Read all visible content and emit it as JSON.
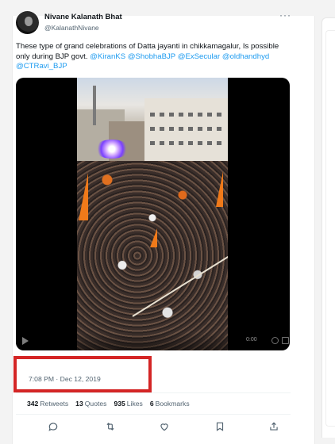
{
  "tweet": {
    "author_name": "Nivane Kalanath Bhat",
    "author_handle": "@KalanathNivane",
    "more_icon": "···",
    "text_plain": "These type of grand celebrations of Datta jayanti in chikkamagalur, Is possible only during BJP govt.",
    "mentions": [
      "@KiranKS",
      "@ShobhaBJP",
      "@ExSecular",
      "@oldhandhyd",
      "@CTRavi_BJP"
    ],
    "video_time": "0:00",
    "timestamp": "7:08 PM · Dec 12, 2019"
  },
  "stats": {
    "retweets_count": "342",
    "retweets_label": "Retweets",
    "quotes_count": "13",
    "quotes_label": "Quotes",
    "likes_count": "935",
    "likes_label": "Likes",
    "bookmarks_count": "6",
    "bookmarks_label": "Bookmarks"
  },
  "actions": [
    "reply-icon",
    "retweet-icon",
    "like-icon",
    "bookmark-icon",
    "share-icon"
  ],
  "colors": {
    "mention": "#1d9bf0",
    "highlight": "#d42525",
    "secondary_text": "#536471"
  }
}
